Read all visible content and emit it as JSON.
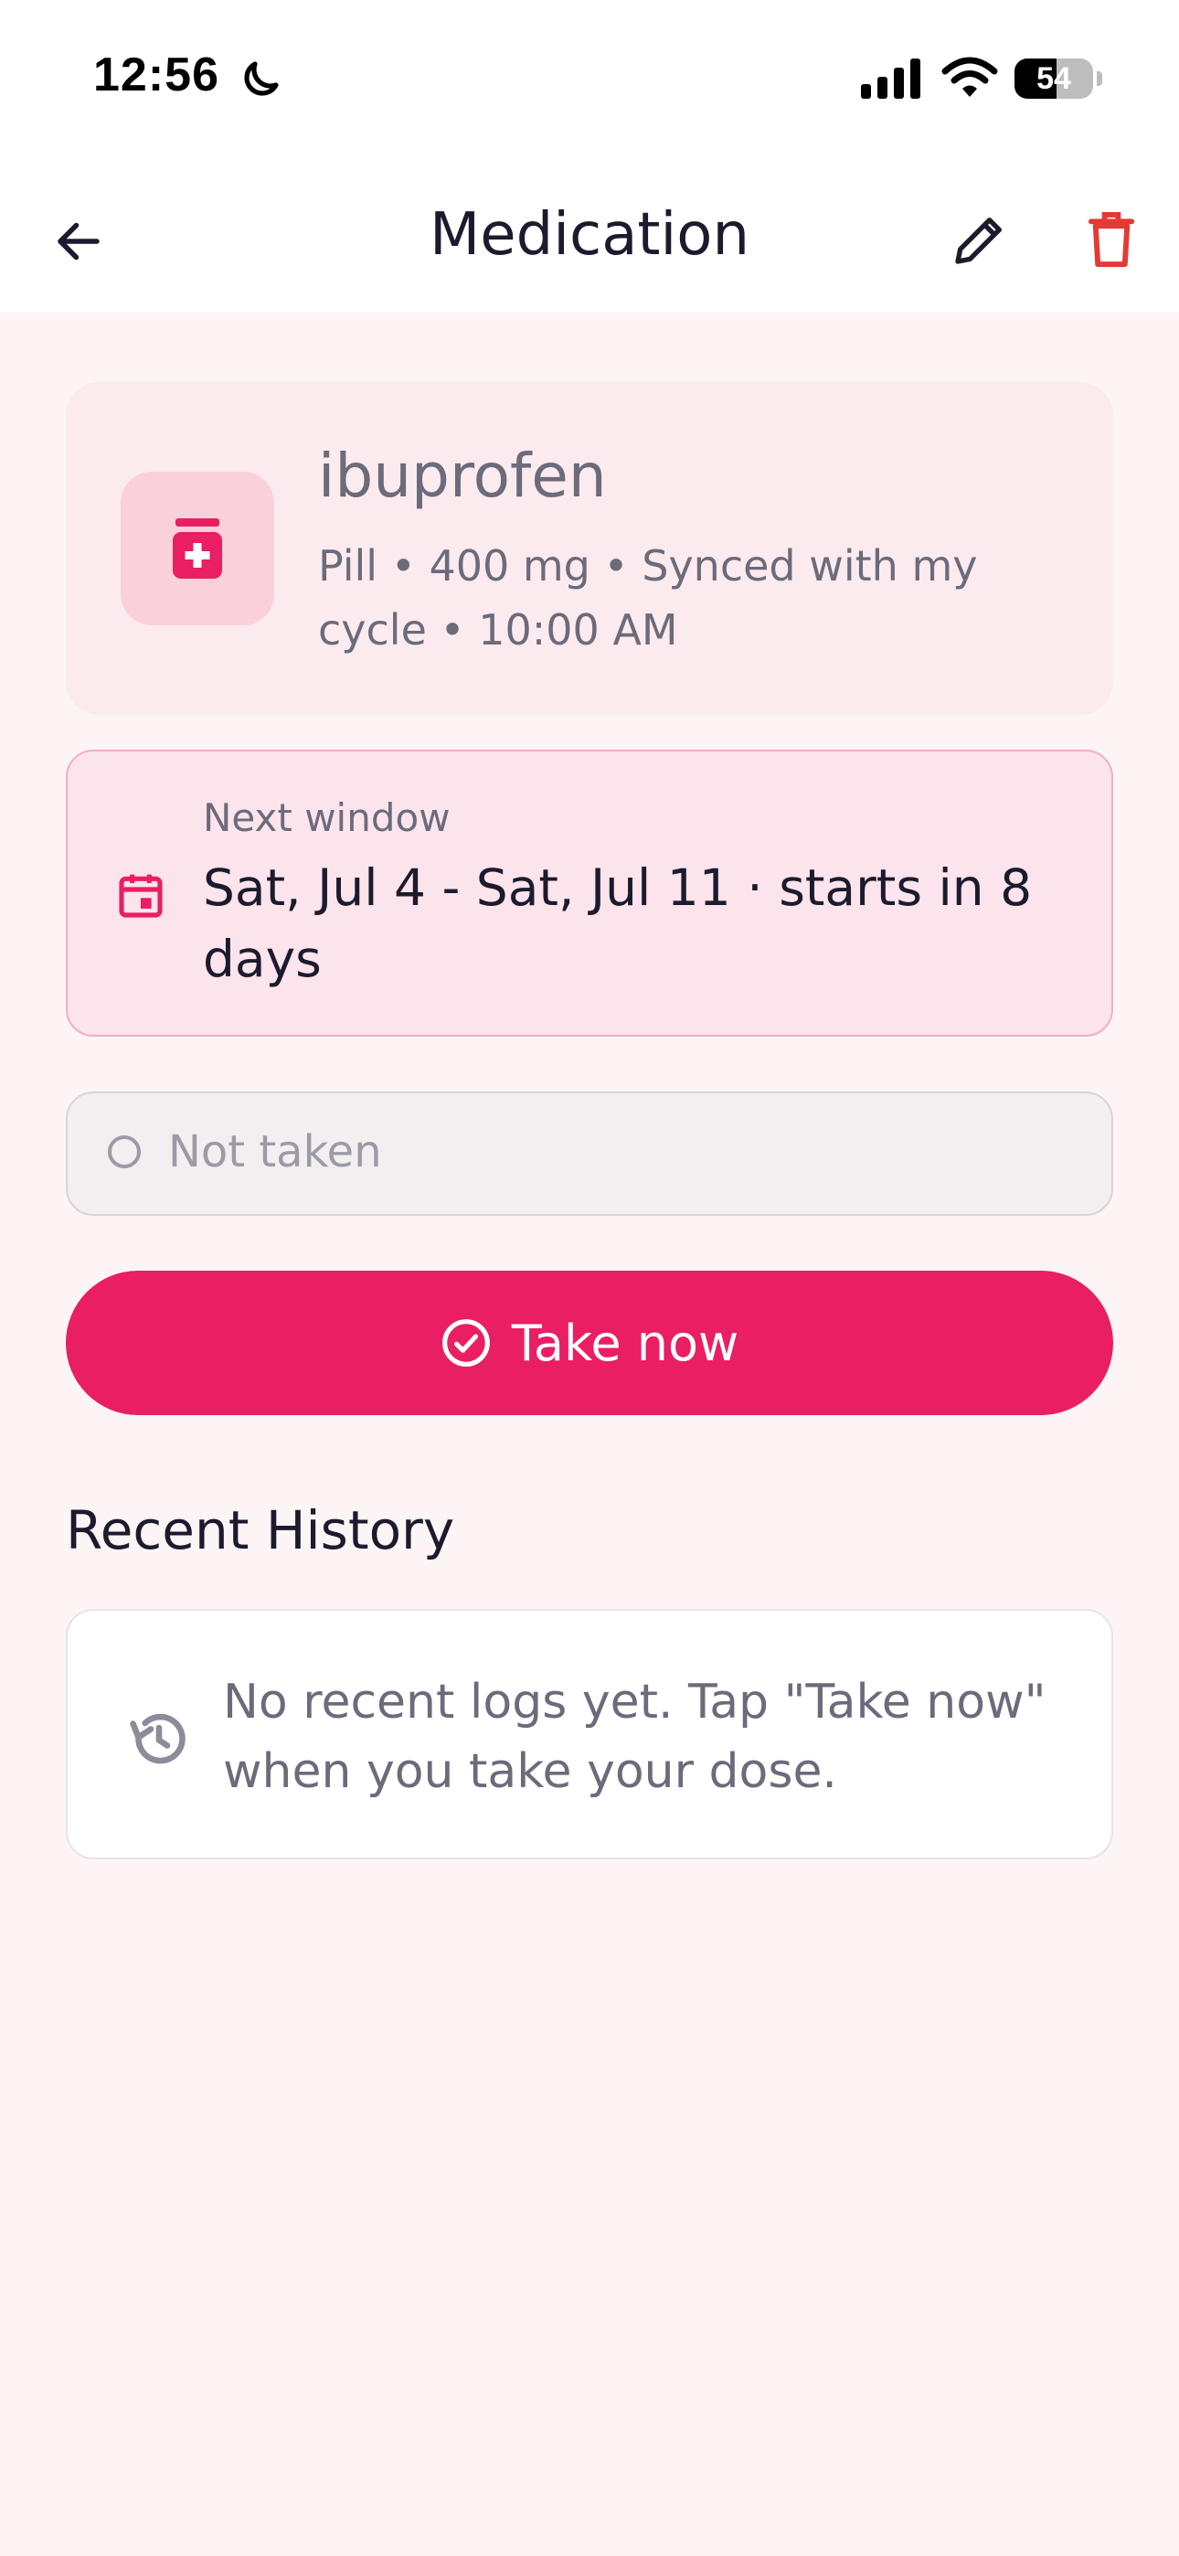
{
  "status_bar": {
    "time": "12:56",
    "battery": "54",
    "battery_level": 0.54
  },
  "nav": {
    "title": "Medication",
    "icons": [
      "arrow-left-icon",
      "pencil-icon",
      "trash-icon"
    ]
  },
  "medication": {
    "name": "ibuprofen",
    "details": "Pill • 400 mg • Synced with my cycle • 10:00 AM",
    "icon": "pill-bottle-icon"
  },
  "next_window": {
    "label": "Next window",
    "text": "Sat, Jul 4 - Sat, Jul 11 · starts in 8 days",
    "icon": "calendar-icon"
  },
  "status": {
    "text": "Not taken"
  },
  "actions": {
    "take_now": "Take now"
  },
  "history": {
    "title": "Recent History",
    "empty_text": "No recent logs yet. Tap \"Take now\" when you take your dose.",
    "icon": "history-icon"
  },
  "colors": {
    "accent": "#e91e63",
    "delete": "#e53935",
    "card": "#fcebee",
    "window": "#fce4ec",
    "background": "#fdf5f5"
  }
}
